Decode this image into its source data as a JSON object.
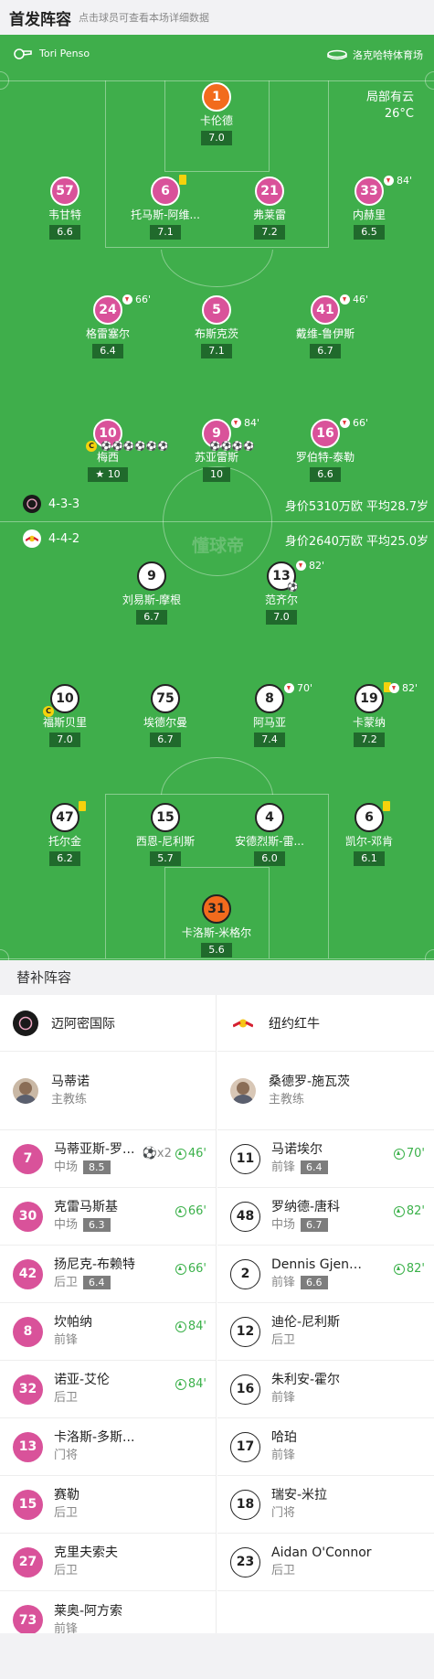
{
  "header": {
    "title": "首发阵容",
    "subtitle": "点击球员可查看本场详细数据"
  },
  "pitch_info": {
    "referee": "Tori Penso",
    "referee_icon": "whistle-icon",
    "venue": "洛克哈特体育场",
    "venue_icon": "stadium-icon",
    "weather": "局部有云",
    "temperature": "26°C"
  },
  "watermark": "懂球帝",
  "home_team": {
    "name": "迈阿密国际",
    "formation": "4-3-3",
    "market_value": "身价5310万欧 平均28.7岁"
  },
  "away_team": {
    "name": "纽约红牛",
    "formation": "4-4-2",
    "market_value": "身价2640万欧 平均25.0岁"
  },
  "home_players": [
    {
      "num": "1",
      "name": "卡伦德",
      "rating": "7.0"
    },
    {
      "num": "57",
      "name": "韦甘特",
      "rating": "6.6"
    },
    {
      "num": "6",
      "name": "托马斯-阿维...",
      "rating": "7.1"
    },
    {
      "num": "21",
      "name": "弗莱雷",
      "rating": "7.2"
    },
    {
      "num": "33",
      "name": "内赫里",
      "rating": "6.5",
      "sub": "84'"
    },
    {
      "num": "24",
      "name": "格雷塞尔",
      "rating": "6.4",
      "sub": "66'"
    },
    {
      "num": "5",
      "name": "布斯克茨",
      "rating": "7.1"
    },
    {
      "num": "41",
      "name": "戴维-鲁伊斯",
      "rating": "6.7",
      "sub": "46'"
    },
    {
      "num": "10",
      "name": "梅西",
      "rating": "10",
      "cap": "C",
      "goal_icons": "⚽⚽⚽⚽⚽⚽"
    },
    {
      "num": "9",
      "name": "苏亚雷斯",
      "rating": "10",
      "sub": "84'",
      "goal_icons": "⚽⚽⚽⚽"
    },
    {
      "num": "16",
      "name": "罗伯特-泰勒",
      "rating": "6.6",
      "sub": "66'"
    }
  ],
  "away_players": [
    {
      "num": "9",
      "name": "刘易斯-摩根",
      "rating": "6.7"
    },
    {
      "num": "13",
      "name": "范齐尔",
      "rating": "7.0",
      "sub": "82'",
      "goal_icons": "⚽"
    },
    {
      "num": "10",
      "name": "福斯贝里",
      "rating": "7.0",
      "cap": "C"
    },
    {
      "num": "75",
      "name": "埃德尔曼",
      "rating": "6.7"
    },
    {
      "num": "8",
      "name": "阿马亚",
      "rating": "7.4",
      "sub": "70'"
    },
    {
      "num": "19",
      "name": "卡蒙纳",
      "rating": "7.2",
      "sub": "82'"
    },
    {
      "num": "47",
      "name": "托尔金",
      "rating": "6.2"
    },
    {
      "num": "15",
      "name": "西恩-尼利斯",
      "rating": "5.7"
    },
    {
      "num": "4",
      "name": "安德烈斯-雷...",
      "rating": "6.0"
    },
    {
      "num": "6",
      "name": "凯尔-邓肯",
      "rating": "6.1"
    },
    {
      "num": "31",
      "name": "卡洛斯-米格尔",
      "rating": "5.6"
    }
  ],
  "substitutes": {
    "title": "替补阵容",
    "home_coach": {
      "name": "马蒂诺",
      "role": "主教练"
    },
    "away_coach": {
      "name": "桑德罗-施瓦茨",
      "role": "主教练"
    },
    "home": [
      {
        "num": "7",
        "name": "马蒂亚斯-罗...",
        "pos": "中场",
        "rating": "8.5",
        "goals": "x2",
        "minute": "46'"
      },
      {
        "num": "30",
        "name": "克雷马斯基",
        "pos": "中场",
        "rating": "6.3",
        "minute": "66'"
      },
      {
        "num": "42",
        "name": "扬尼克-布赖特",
        "pos": "后卫",
        "rating": "6.4",
        "minute": "66'"
      },
      {
        "num": "8",
        "name": "坎帕纳",
        "pos": "前锋",
        "minute": "84'"
      },
      {
        "num": "32",
        "name": "诺亚-艾伦",
        "pos": "后卫",
        "minute": "84'"
      },
      {
        "num": "13",
        "name": "卡洛斯-多斯...",
        "pos": "门将"
      },
      {
        "num": "15",
        "name": "赛勒",
        "pos": "后卫"
      },
      {
        "num": "27",
        "name": "克里夫索夫",
        "pos": "后卫"
      },
      {
        "num": "73",
        "name": "莱奥-阿方索",
        "pos": "前锋"
      }
    ],
    "away": [
      {
        "num": "11",
        "name": "马诺埃尔",
        "pos": "前锋",
        "rating": "6.4",
        "minute": "70'"
      },
      {
        "num": "48",
        "name": "罗纳德-唐科",
        "pos": "中场",
        "rating": "6.7",
        "minute": "82'"
      },
      {
        "num": "2",
        "name": "Dennis Gjeng...",
        "pos": "前锋",
        "rating": "6.6",
        "minute": "82'"
      },
      {
        "num": "12",
        "name": "迪伦-尼利斯",
        "pos": "后卫"
      },
      {
        "num": "16",
        "name": "朱利安-霍尔",
        "pos": "前锋"
      },
      {
        "num": "17",
        "name": "哈珀",
        "pos": "前锋"
      },
      {
        "num": "18",
        "name": "瑞安-米拉",
        "pos": "门将"
      },
      {
        "num": "23",
        "name": "Aidan O'Connor",
        "pos": "后卫"
      }
    ]
  },
  "colors": {
    "pitch": "#3fae4b",
    "home": "#d9529a",
    "goalkeeper": "#f26b1d",
    "rating_bg": "#206a2c"
  }
}
